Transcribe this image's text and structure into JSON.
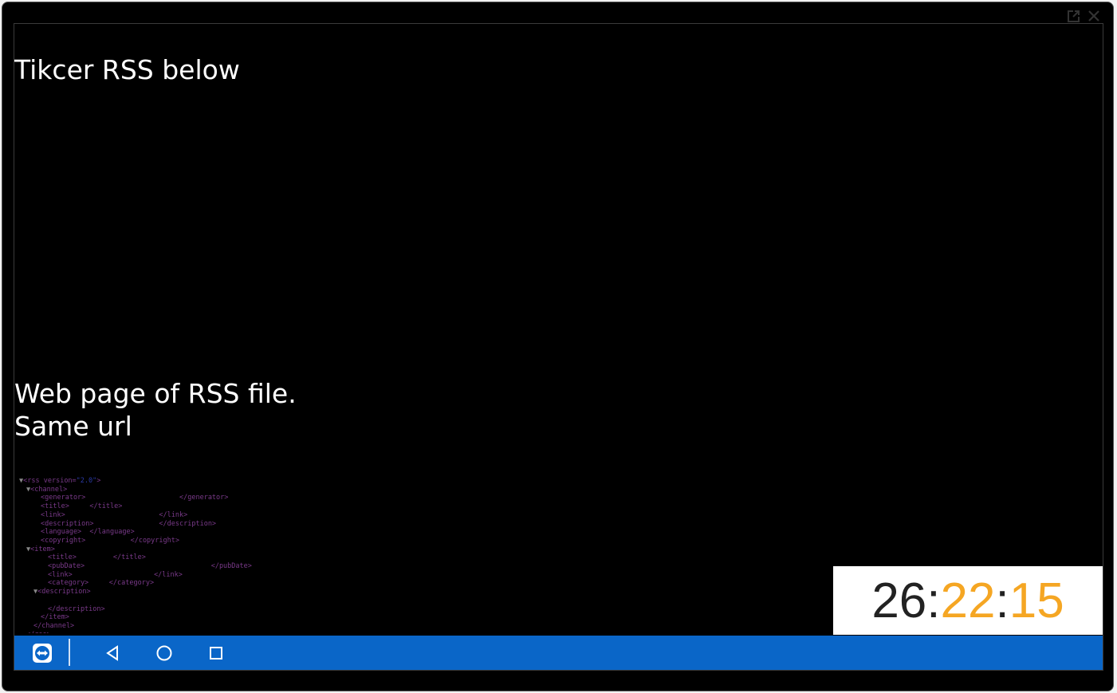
{
  "screen": {
    "headline": "Tikcer RSS below",
    "webpage_label_line1": "Web page of RSS file.",
    "webpage_label_line2": "Same url"
  },
  "rss_tree": [
    {
      "indent": 0,
      "tri": "▼",
      "tag": "<rss",
      "attr": " version=",
      "val": "\"2.0\"",
      "end": ">"
    },
    {
      "indent": 1,
      "tri": "▼",
      "tag": "<channel>",
      "attr": "",
      "val": "",
      "end": ""
    },
    {
      "indent": 2,
      "tri": "",
      "tag": "<generator>",
      "attr": "",
      "val": "",
      "end": "                       </generator>"
    },
    {
      "indent": 2,
      "tri": "",
      "tag": "<title>",
      "attr": "",
      "val": "",
      "end": "     </title>"
    },
    {
      "indent": 2,
      "tri": "",
      "tag": "<link>",
      "attr": "",
      "val": "",
      "end": "                       </link>"
    },
    {
      "indent": 2,
      "tri": "",
      "tag": "<description>",
      "attr": "",
      "val": "",
      "end": "                </description>"
    },
    {
      "indent": 2,
      "tri": "",
      "tag": "<language>",
      "attr": "",
      "val": "",
      "end": "  </language>"
    },
    {
      "indent": 2,
      "tri": "",
      "tag": "<copyright>",
      "attr": "",
      "val": "",
      "end": "           </copyright>"
    },
    {
      "indent": 1,
      "tri": "▼",
      "tag": "<item>",
      "attr": "",
      "val": "",
      "end": ""
    },
    {
      "indent": 3,
      "tri": "",
      "tag": "<title>",
      "attr": "",
      "val": "",
      "end": "         </title>"
    },
    {
      "indent": 3,
      "tri": "",
      "tag": "<pubDate>",
      "attr": "",
      "val": "",
      "end": "                               </pubDate>"
    },
    {
      "indent": 3,
      "tri": "",
      "tag": "<link>",
      "attr": "",
      "val": "",
      "end": "                    </link>"
    },
    {
      "indent": 3,
      "tri": "",
      "tag": "<category>",
      "attr": "",
      "val": "",
      "end": "     </category>"
    },
    {
      "indent": 2,
      "tri": "▼",
      "tag": "<description>",
      "attr": "",
      "val": "",
      "end": ""
    },
    {
      "indent": 0,
      "tri": "",
      "tag": "",
      "attr": "",
      "val": "",
      "end": ""
    },
    {
      "indent": 3,
      "tri": "",
      "tag": "</description>",
      "attr": "",
      "val": "",
      "end": ""
    },
    {
      "indent": 2,
      "tri": "",
      "tag": "</item>",
      "attr": "",
      "val": "",
      "end": ""
    },
    {
      "indent": 1,
      "tri": "",
      "tag": "</channel>",
      "attr": "",
      "val": "",
      "end": ""
    },
    {
      "indent": 0,
      "tri": "",
      "tag": "</rss>",
      "attr": "",
      "val": "",
      "end": ""
    }
  ],
  "clock": {
    "hours": "26",
    "minutes": "22",
    "seconds": "15",
    "separator": ":"
  },
  "icons": {
    "popout": "popout-icon",
    "close": "close-icon",
    "remote": "teamviewer-icon",
    "back": "back-triangle-icon",
    "home": "home-circle-icon",
    "recents": "recents-square-icon"
  },
  "colors": {
    "navbar": "#0a66c8",
    "clock_accent": "#f5a623",
    "background": "#000000"
  }
}
